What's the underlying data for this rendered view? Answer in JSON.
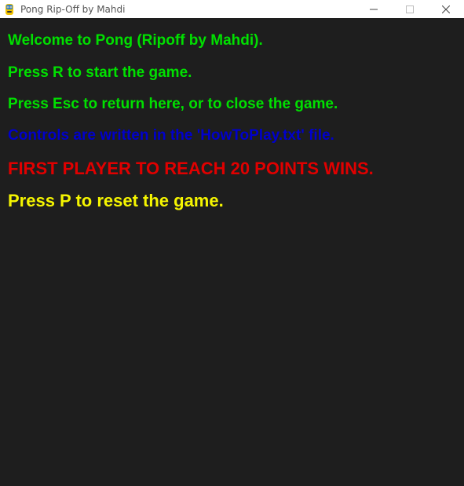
{
  "window": {
    "title": "Pong Rip-Off by Mahdi",
    "icon": "pygame-snake-icon",
    "controls": [
      "minimize-icon",
      "maximize-icon",
      "close-icon"
    ]
  },
  "colors": {
    "background": "#1e1e1e",
    "green": "#00e000",
    "blue": "#0000cc",
    "red": "#e00000",
    "yellow": "#f5f500"
  },
  "menu": {
    "welcome": "Welcome to Pong (Ripoff by Mahdi).",
    "start": "Press R to start the game.",
    "escape": "Press Esc to return here, or to close the game.",
    "controls": "Controls are written in the 'HowToPlay.txt' file.",
    "win_condition": "FIRST PLAYER TO REACH 20 POINTS WINS.",
    "reset": "Press P to reset the game."
  }
}
